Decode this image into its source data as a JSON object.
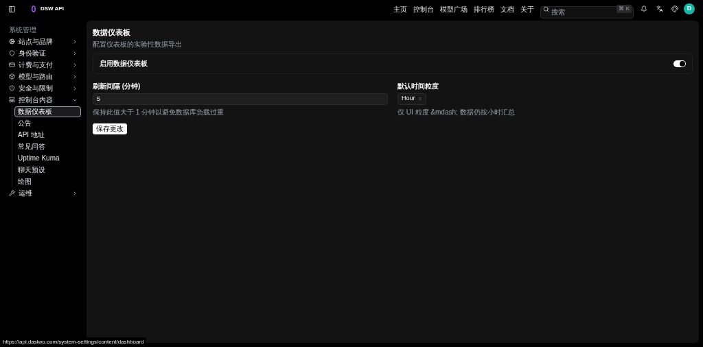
{
  "header": {
    "brand": "DSW API",
    "nav": [
      "主页",
      "控制台",
      "模型广场",
      "排行榜",
      "文档",
      "关于"
    ],
    "search": {
      "placeholder": "搜索",
      "shortcut": "⌘ K"
    },
    "avatar": "D"
  },
  "sidebar": {
    "section": "系统管理",
    "items": [
      {
        "label": "站点与品牌",
        "expanded": false
      },
      {
        "label": "身份验证",
        "expanded": false
      },
      {
        "label": "计费与支付",
        "expanded": false
      },
      {
        "label": "模型与路由",
        "expanded": false
      },
      {
        "label": "安全与限制",
        "expanded": false
      },
      {
        "label": "控制台内容",
        "expanded": true,
        "children": [
          {
            "label": "数据仪表板",
            "selected": true
          },
          {
            "label": "公告",
            "selected": false
          },
          {
            "label": "API 地址",
            "selected": false
          },
          {
            "label": "常见问答",
            "selected": false
          },
          {
            "label": "Uptime Kuma",
            "selected": false
          },
          {
            "label": "聊天预设",
            "selected": false
          },
          {
            "label": "绘图",
            "selected": false
          }
        ]
      },
      {
        "label": "运维",
        "expanded": false
      }
    ]
  },
  "page": {
    "title": "数据仪表板",
    "subtitle": "配置仪表板的实验性数据导出",
    "toggle": {
      "label": "启用数据仪表板",
      "on": true
    },
    "interval": {
      "label": "刷新间隔 (分钟)",
      "value": "5",
      "hint": "保持此值大于 1 分钟以避免数据库负载过重"
    },
    "granularity": {
      "label": "默认时间粒度",
      "value": "Hour",
      "hint": "仅 UI 粒度 &mdash; 数据仍按小时汇总"
    },
    "save": "保存更改"
  },
  "status_url": "https://api.dasiwo.com/system-settings/content/dashboard"
}
